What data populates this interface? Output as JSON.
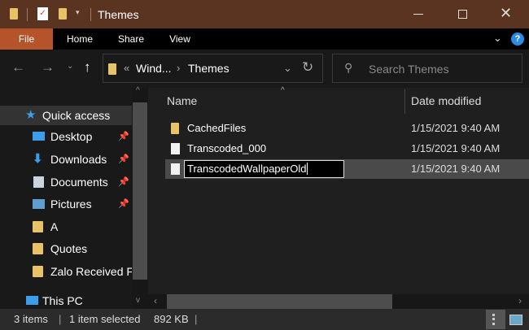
{
  "window": {
    "title": "Themes"
  },
  "ribbon": {
    "tabs": [
      "File",
      "Home",
      "Share",
      "View"
    ]
  },
  "address": {
    "overflow": "«",
    "crumbs": [
      "Wind...",
      "Themes"
    ],
    "search_placeholder": "Search Themes"
  },
  "sidebar": {
    "items": [
      {
        "label": "Quick access",
        "icon": "star-icon",
        "pinned": false
      },
      {
        "label": "Desktop",
        "icon": "desktop-icon",
        "pinned": true
      },
      {
        "label": "Downloads",
        "icon": "download-icon",
        "pinned": true
      },
      {
        "label": "Documents",
        "icon": "documents-icon",
        "pinned": true
      },
      {
        "label": "Pictures",
        "icon": "pictures-icon",
        "pinned": true
      },
      {
        "label": "A",
        "icon": "folder-icon",
        "pinned": false
      },
      {
        "label": "Quotes",
        "icon": "folder-icon",
        "pinned": false
      },
      {
        "label": "Zalo Received Fi",
        "icon": "folder-icon",
        "pinned": false
      },
      {
        "label": "This PC",
        "icon": "computer-icon",
        "pinned": false
      }
    ]
  },
  "columns": {
    "name": "Name",
    "date": "Date modified"
  },
  "files": [
    {
      "name": "CachedFiles",
      "date": "1/15/2021 9:40 AM",
      "type": "folder"
    },
    {
      "name": "Transcoded_000",
      "date": "1/15/2021 9:40 AM",
      "type": "file"
    },
    {
      "name": "TranscodedWallpaperOld",
      "date": "1/15/2021 9:40 AM",
      "type": "file",
      "renaming": true
    }
  ],
  "status": {
    "items": "3 items",
    "selected": "1 item selected",
    "size": "892 KB"
  },
  "colors": {
    "titlebar": "#5a3420",
    "file_tab": "#b5532a",
    "accent": "#2b8ae6"
  }
}
